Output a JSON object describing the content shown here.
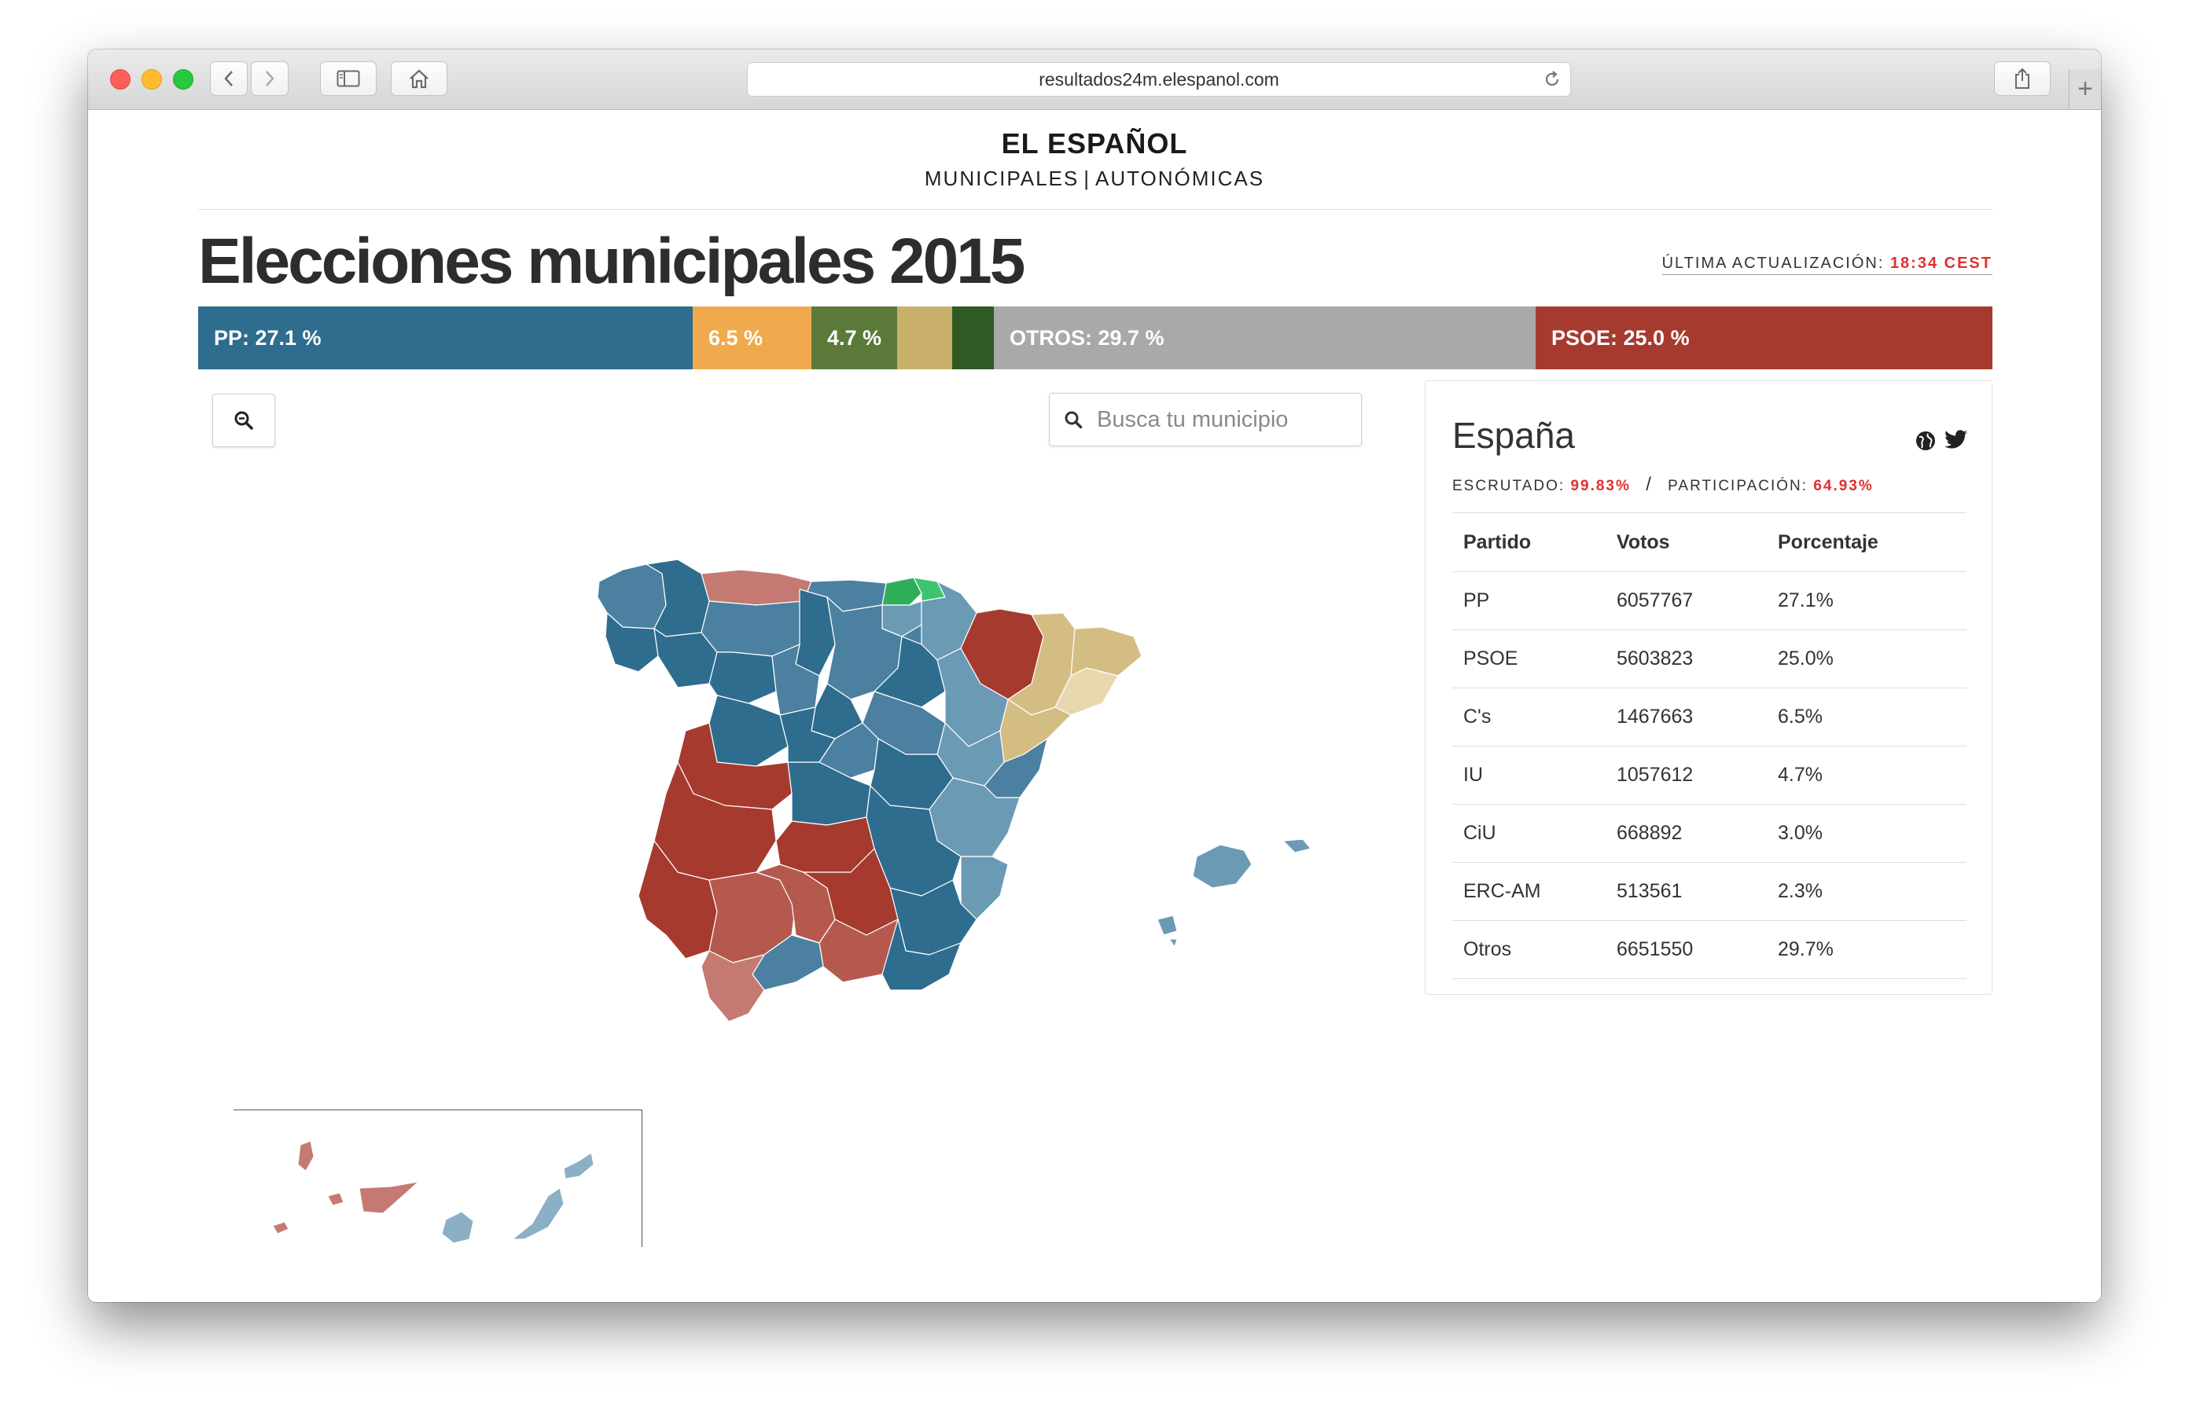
{
  "browser": {
    "url": "resultados24m.elespanol.com"
  },
  "site": {
    "logo": "EL ESPAÑOL",
    "nav_municipales": "MUNICIPALES",
    "nav_separator": "|",
    "nav_autonomicas": "AUTONÓMICAS"
  },
  "header": {
    "title": "Elecciones municipales 2015",
    "update_label": "ÚLTIMA ACTUALIZACIÓN:",
    "update_time": "18:34 CEST"
  },
  "party_bar": [
    {
      "label": "PP: 27.1 %",
      "share": 27.1,
      "color": "#2e6d8e"
    },
    {
      "label": "6.5 %",
      "share": 6.5,
      "color": "#f0aa4d"
    },
    {
      "label": "4.7 %",
      "share": 4.7,
      "color": "#5b7a3a"
    },
    {
      "label": "",
      "share": 3.0,
      "color": "#c8b06a"
    },
    {
      "label": "",
      "share": 2.3,
      "color": "#2f5a24"
    },
    {
      "label": "OTROS: 29.7 %",
      "share": 29.7,
      "color": "#a9a9a9"
    },
    {
      "label": "PSOE: 25.0 %",
      "share": 25.0,
      "color": "#a63a2e"
    }
  ],
  "search": {
    "placeholder": "Busca tu municipio"
  },
  "map": {
    "colors": {
      "pp_dark": "#2e6d8e",
      "pp_mid": "#4b80a0",
      "pp_light": "#6b9ab5",
      "pp_pale": "#8bb0c6",
      "psoe_dark": "#a63a2e",
      "psoe_mid": "#b5594f",
      "psoe_light": "#c47a72",
      "pnv": "#3ec46f",
      "bildu": "#2fae5a",
      "ciu": "#d4bd82",
      "erc": "#e8d8b0"
    }
  },
  "results": {
    "region": "España",
    "icons": [
      "globe-icon",
      "twitter-icon"
    ],
    "escrutado_label": "ESCRUTADO:",
    "escrutado_value": "99.83%",
    "separator": "/",
    "participacion_label": "PARTICIPACIÓN:",
    "participacion_value": "64.93%",
    "columns": [
      "Partido",
      "Votos",
      "Porcentaje"
    ],
    "rows": [
      {
        "partido": "PP",
        "votos": "6057767",
        "porcentaje": "27.1%"
      },
      {
        "partido": "PSOE",
        "votos": "5603823",
        "porcentaje": "25.0%"
      },
      {
        "partido": "C's",
        "votos": "1467663",
        "porcentaje": "6.5%"
      },
      {
        "partido": "IU",
        "votos": "1057612",
        "porcentaje": "4.7%"
      },
      {
        "partido": "CiU",
        "votos": "668892",
        "porcentaje": "3.0%"
      },
      {
        "partido": "ERC-AM",
        "votos": "513561",
        "porcentaje": "2.3%"
      },
      {
        "partido": "Otros",
        "votos": "6651550",
        "porcentaje": "29.7%"
      }
    ]
  }
}
